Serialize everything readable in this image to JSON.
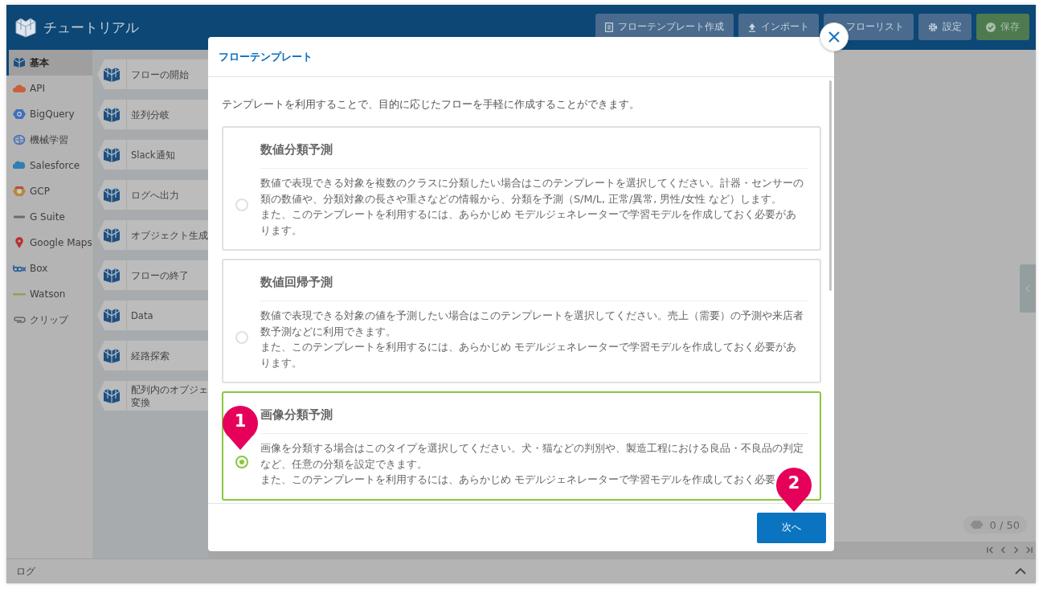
{
  "header": {
    "title": "チュートリアル",
    "buttons": [
      {
        "label": "フローテンプレート作成",
        "kind": "template"
      },
      {
        "label": "インポート",
        "kind": "import"
      },
      {
        "label": "フローリスト",
        "kind": "list"
      },
      {
        "label": "設定",
        "kind": "settings"
      },
      {
        "label": "保存",
        "kind": "save"
      }
    ]
  },
  "sidebar": {
    "items": [
      {
        "label": "基本",
        "kind": "flow",
        "selected": true
      },
      {
        "label": "API",
        "kind": "api",
        "selected": false
      },
      {
        "label": "BigQuery",
        "kind": "bigquery",
        "selected": false
      },
      {
        "label": "機械学習",
        "kind": "ml",
        "selected": false
      },
      {
        "label": "Salesforce",
        "kind": "salesforce",
        "selected": false
      },
      {
        "label": "GCP",
        "kind": "gcp",
        "selected": false
      },
      {
        "label": "G Suite",
        "kind": "gsuite",
        "selected": false
      },
      {
        "label": "Google Maps",
        "kind": "maps",
        "selected": false
      },
      {
        "label": "Box",
        "kind": "box",
        "selected": false
      },
      {
        "label": "Watson",
        "kind": "watson",
        "selected": false
      },
      {
        "label": "クリップ",
        "kind": "clip",
        "selected": false
      }
    ]
  },
  "nodes": [
    {
      "lines": [
        "フローの開始"
      ]
    },
    {
      "lines": [
        "並列分岐"
      ]
    },
    {
      "lines": [
        "Slack通知"
      ]
    },
    {
      "lines": [
        "ログへ出力"
      ]
    },
    {
      "lines": [
        "オブジェクト生成"
      ]
    },
    {
      "lines": [
        "フローの終了"
      ]
    },
    {
      "lines": [
        "Data"
      ]
    },
    {
      "lines": [
        "経路探索"
      ]
    },
    {
      "lines": [
        "配列内のオブジェ",
        "変換"
      ]
    }
  ],
  "counter": "0 / 50",
  "log_bar": {
    "title": "ログ"
  },
  "modal": {
    "title": "フローテンプレート",
    "intro": "テンプレートを利用することで、目的に応じたフローを手軽に作成することができます。",
    "templates": [
      {
        "title": "数値分類予測",
        "selected": false,
        "paragraphs": [
          "数値で表現できる対象を複数のクラスに分類したい場合はこのテンプレートを選択してください。計器・センサーの類の数値や、分類対象の長さや重さなどの情報から、分類を予測（S/M/L, 正常/異常, 男性/女性 など）します。",
          "また、このテンプレートを利用するには、あらかじめ モデルジェネレーターで学習モデルを作成しておく必要があります。"
        ]
      },
      {
        "title": "数値回帰予測",
        "selected": false,
        "paragraphs": [
          "数値で表現できる対象の値を予測したい場合はこのテンプレートを選択してください。売上（需要）の予測や来店者数予測などに利用できます。",
          "また、このテンプレートを利用するには、あらかじめ モデルジェネレーターで学習モデルを作成しておく必要があります。"
        ]
      },
      {
        "title": "画像分類予測",
        "selected": true,
        "paragraphs": [
          "画像を分類する場合はこのタイプを選択してください。犬・猫などの判別や、製造工程における良品・不良品の判定など、任意の分類を設定できます。",
          "また、このテンプレートを利用するには、あらかじめ モデルジェネレーターで学習モデルを作成しておく必要"
        ]
      }
    ],
    "next_button": "次へ"
  },
  "markers": [
    "1",
    "2"
  ]
}
